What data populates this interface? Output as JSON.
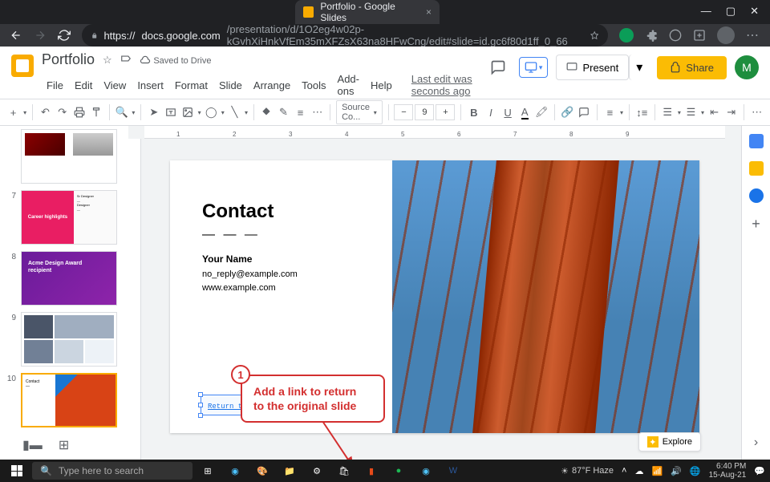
{
  "browser": {
    "tab_title": "Portfolio - Google Slides",
    "url_prefix": "https://",
    "url_host": "docs.google.com",
    "url_path": "/presentation/d/1O2eg4w02p-kGvhXiHnkVfEm35mXFZsX63na8HFwCng/edit#slide=id.gc6f80d1ff_0_66"
  },
  "app": {
    "title": "Portfolio",
    "saved_label": "Saved to Drive",
    "menus": [
      "File",
      "Edit",
      "View",
      "Insert",
      "Format",
      "Slide",
      "Arrange",
      "Tools",
      "Add-ons",
      "Help"
    ],
    "last_edit": "Last edit was seconds ago",
    "present": "Present",
    "share": "Share",
    "avatar_letter": "M",
    "font_name": "Source Co...",
    "font_size": "9",
    "explore": "Explore"
  },
  "thumbs": {
    "n7": "7",
    "n8": "8",
    "n9": "9",
    "n10": "10",
    "career": "Career highlights",
    "acme1": "Acme Design Award",
    "acme2": "recipient"
  },
  "slide": {
    "heading": "Contact",
    "dashes": "— — —",
    "name": "Your Name",
    "email": "no_reply@example.com",
    "web": "www.example.com",
    "link_text": "Return to Linked slide"
  },
  "callout": {
    "num": "1",
    "line1": "Add a link to return",
    "line2": "to the original slide"
  },
  "taskbar": {
    "search_placeholder": "Type here to search",
    "weather": "87°F Haze",
    "time": "6:40 PM",
    "date": "15-Aug-21"
  },
  "ruler": {
    "r1": "1",
    "r2": "2",
    "r3": "3",
    "r4": "4",
    "r5": "5",
    "r6": "6",
    "r7": "7",
    "r8": "8",
    "r9": "9"
  }
}
